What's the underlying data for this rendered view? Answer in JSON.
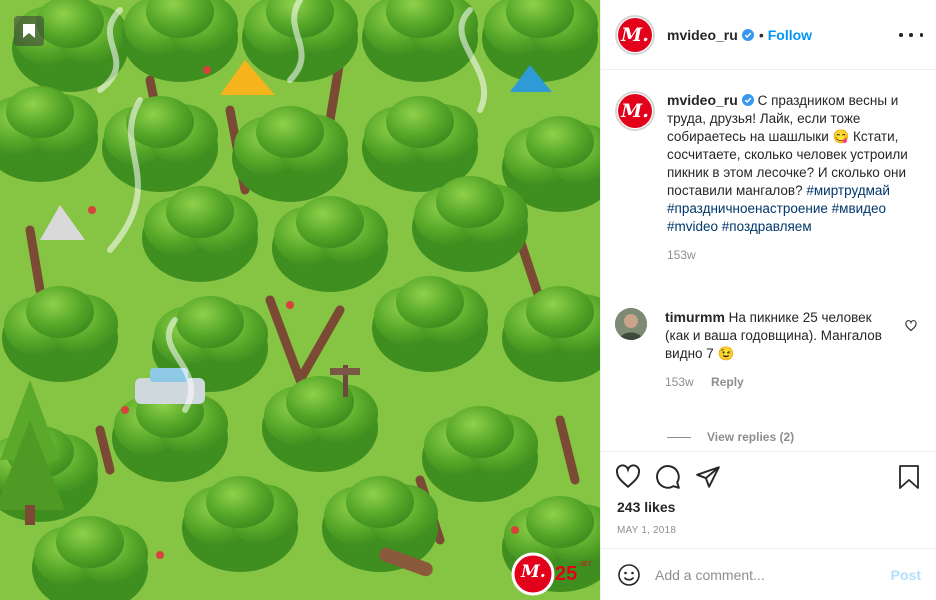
{
  "post": {
    "username": "mvideo_ru",
    "follow_label": "Follow",
    "dot": "•",
    "avatar_letter": "M.",
    "caption": {
      "text_plain": "С праздником весны и труда, друзья! Лайк, если тоже собираетесь на шашлыки 😋 Кстати, сосчитаете, сколько человек устроили пикник в этом лесочке? И сколько они поставили мангалов?",
      "hashtags": [
        "#миртрудмай",
        "#праздничноенастроение",
        "#мвидео",
        "#mvideo",
        "#поздравляем"
      ],
      "age": "153w"
    },
    "comment": {
      "username": "timurmm",
      "text": "На пикнике 25 человек (как и ваша годовщина). Мангалов видно 7 😉",
      "age": "153w",
      "reply_label": "Reply",
      "view_replies": "View replies (2)"
    },
    "likes": "243 likes",
    "date": "MAY 1, 2018",
    "add_comment_placeholder": "Add a comment...",
    "post_label": "Post"
  },
  "image_badge": {
    "logo_letter": "M.",
    "number": "25",
    "small_text": "ЛЕТ"
  },
  "colors": {
    "brand_red": "#e3001b",
    "follow_blue": "#0095f6",
    "hashtag_blue": "#00376b",
    "grass": "#7fc23d"
  },
  "icons": [
    "bookmark-icon",
    "verified-icon",
    "more-options-icon",
    "heart-icon",
    "comment-icon",
    "share-icon",
    "save-icon",
    "emoji-icon"
  ]
}
